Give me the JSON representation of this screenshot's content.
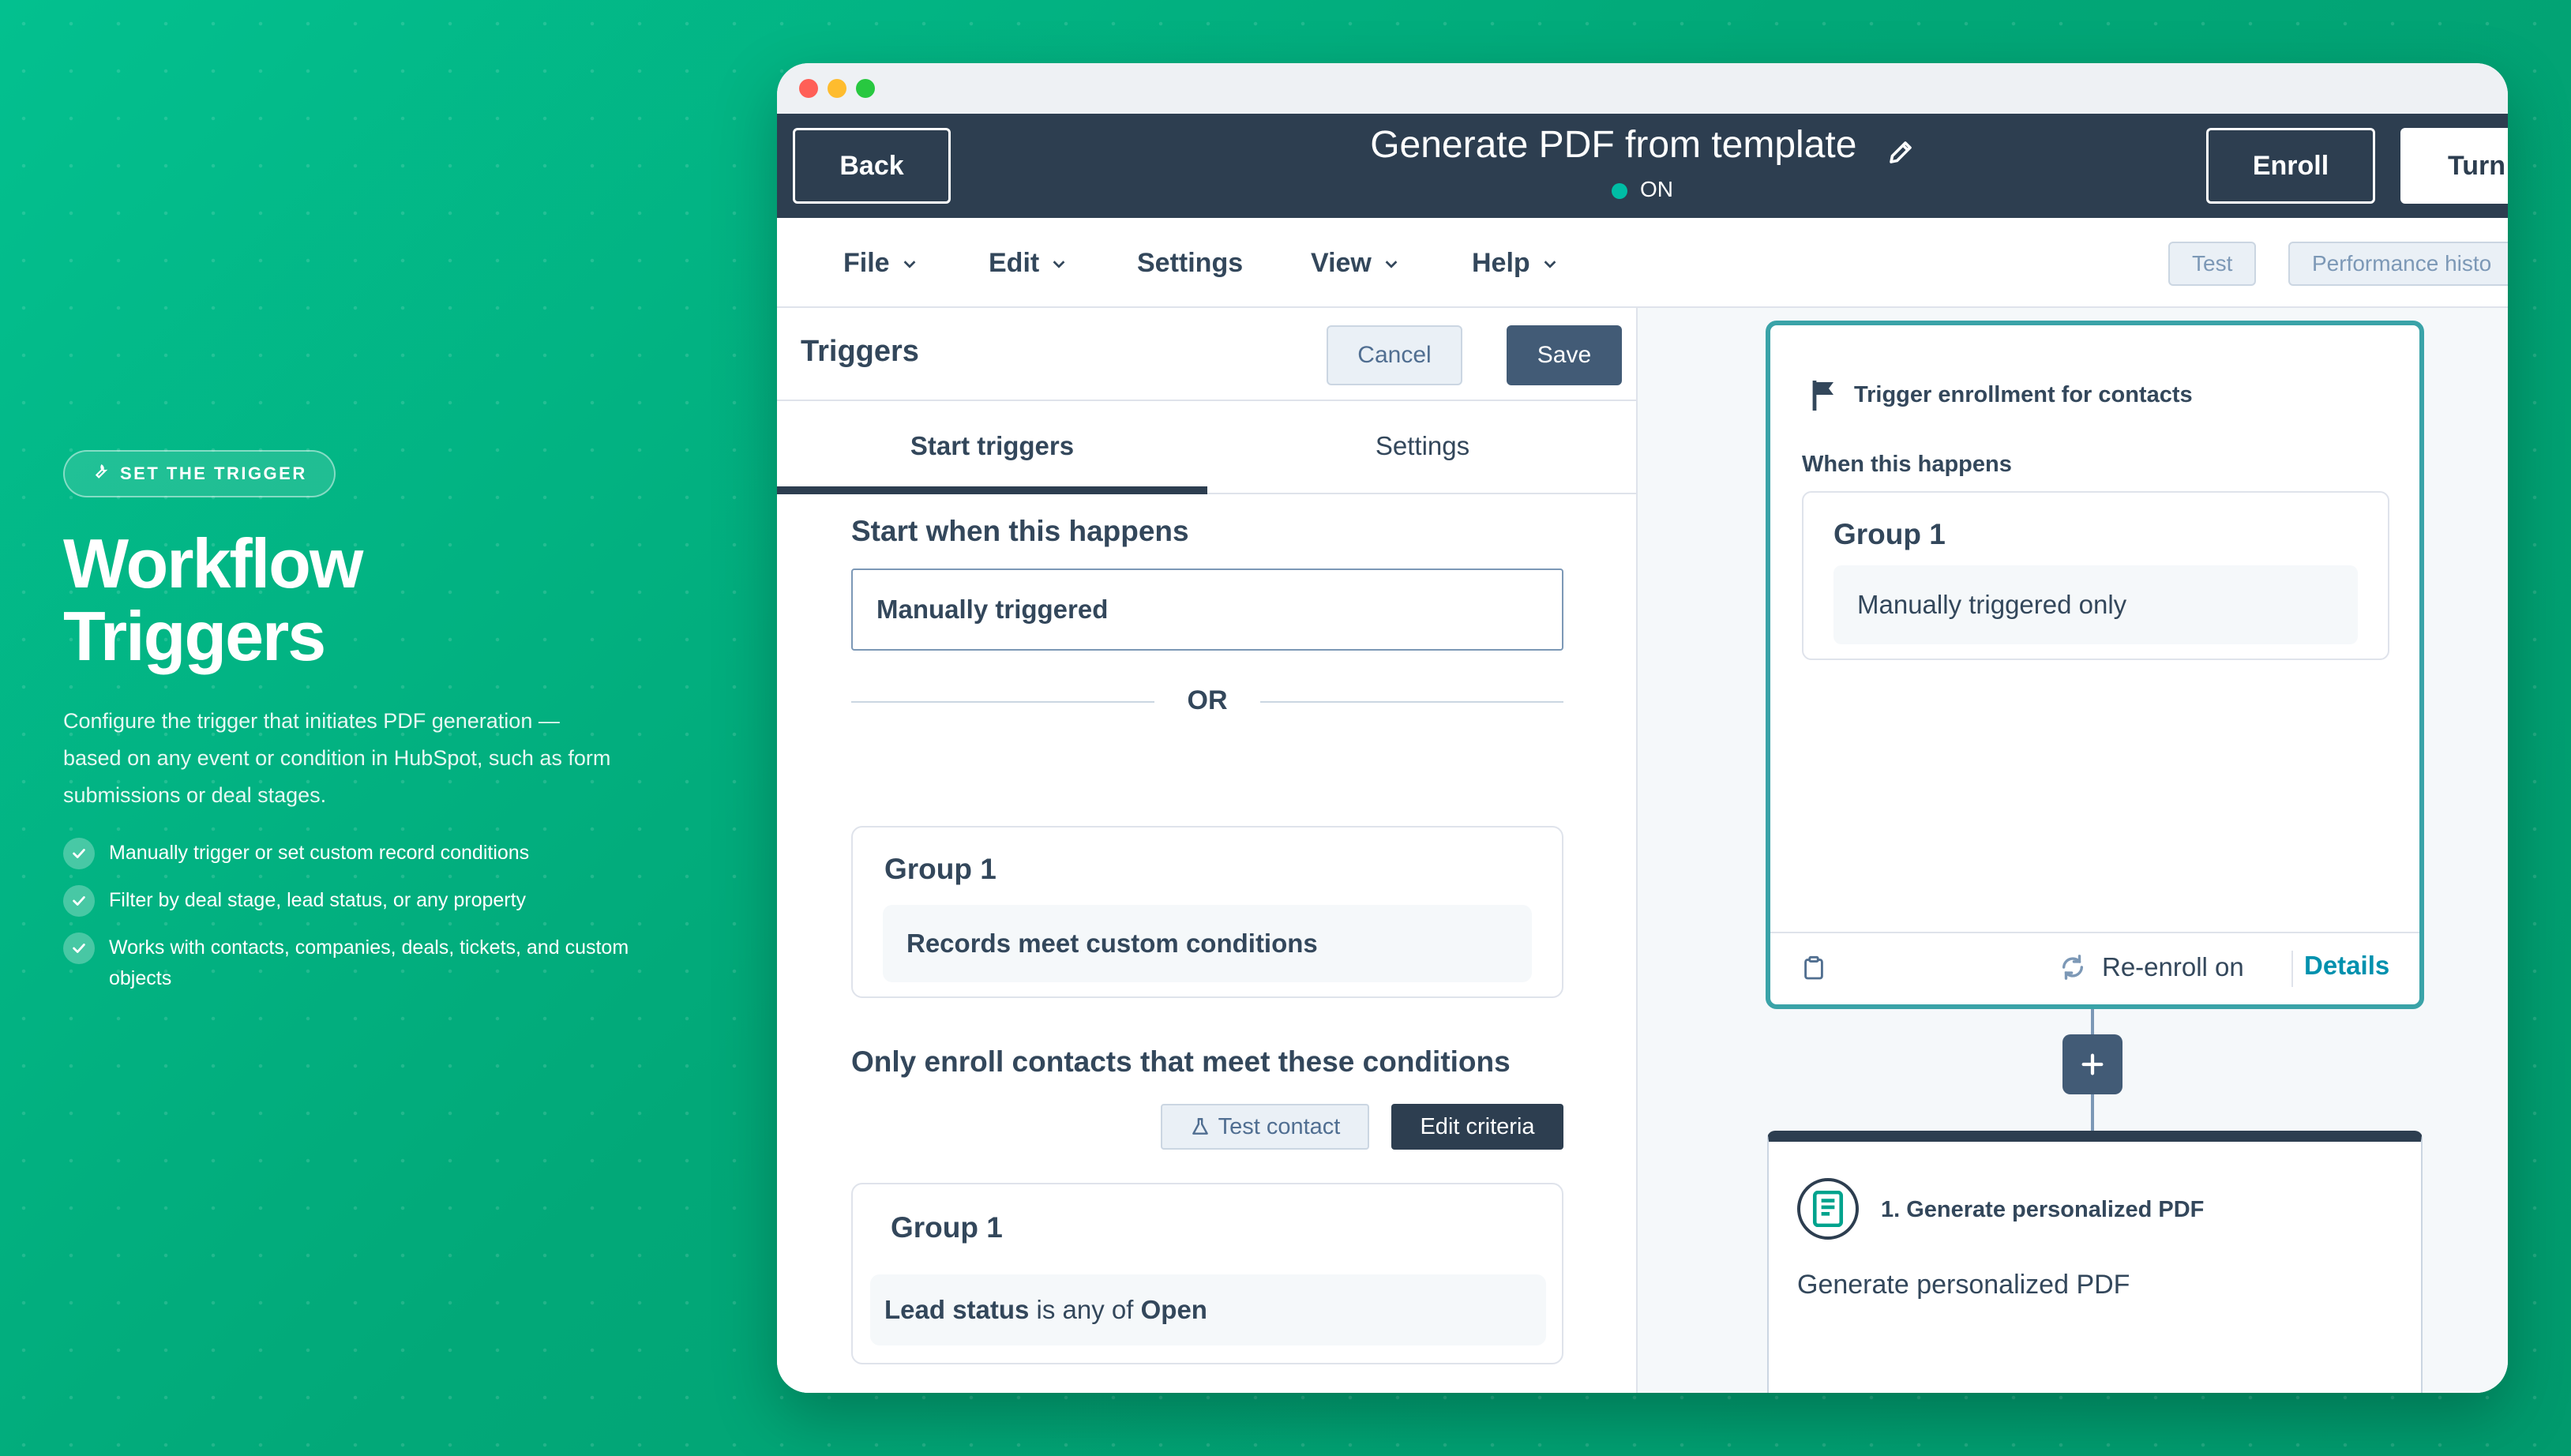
{
  "promo": {
    "pill": "SET THE TRIGGER",
    "title_line1": "Workflow",
    "title_line2": "Triggers",
    "description": "Configure the trigger that initiates PDF generation — based on any event or condition in HubSpot, such as form submissions or deal stages.",
    "features": [
      "Manually trigger or set custom record conditions",
      "Filter by deal stage, lead status, or any property",
      "Works with contacts, companies, deals, tickets, and custom objects"
    ]
  },
  "topbar": {
    "back": "Back",
    "title": "Generate PDF from template",
    "status": "ON",
    "enroll": "Enroll",
    "turn": "Turn"
  },
  "menu": {
    "file": "File",
    "edit": "Edit",
    "settings": "Settings",
    "view": "View",
    "help": "Help",
    "test": "Test",
    "performance": "Performance histo"
  },
  "triggers_panel": {
    "title": "Triggers",
    "cancel": "Cancel",
    "save": "Save",
    "tab_start": "Start triggers",
    "tab_settings": "Settings",
    "start_label": "Start when this happens",
    "manual_value": "Manually triggered",
    "or": "OR",
    "group1_title": "Group 1",
    "group1_row": "Records meet custom conditions",
    "only_enroll_label": "Only enroll contacts that meet these conditions",
    "test_contact": "Test contact",
    "edit_criteria": "Edit criteria",
    "group2_title": "Group 1",
    "group2_prop": "Lead status",
    "group2_op": " is any of ",
    "group2_val": "Open"
  },
  "canvas": {
    "trigger_head": "Trigger enrollment for contacts",
    "when": "When this happens",
    "group_title": "Group 1",
    "group_row": "Manually triggered only",
    "reenroll": "Re-enroll on",
    "details": "Details",
    "action_title": "1. Generate personalized PDF",
    "action_desc": "Generate personalized PDF"
  },
  "colors": {
    "brand_green": "#02a878",
    "nav_dark": "#2d3e50",
    "status_on": "#00bda5",
    "link": "#0091ae",
    "card_border": "#3aa3a8"
  }
}
